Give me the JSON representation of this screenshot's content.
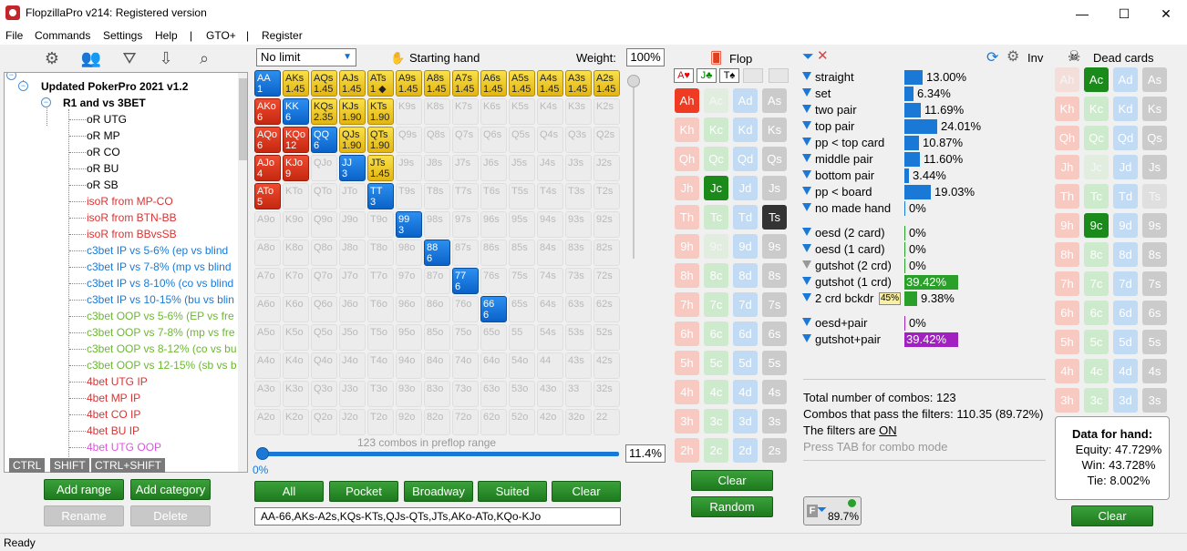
{
  "window": {
    "title": "FlopzillaPro v214: Registered version",
    "min": "—",
    "max": "☐",
    "close": "✕"
  },
  "menu": [
    "File",
    "Commands",
    "Settings",
    "Help",
    "|",
    "GTO+",
    "|",
    "Register"
  ],
  "tree": {
    "root": "Updated PokerPro 2021 v1.2",
    "group": "R1 and vs 3BET",
    "items": [
      {
        "label": "oR UTG",
        "color": "#000000"
      },
      {
        "label": "oR MP",
        "color": "#000000"
      },
      {
        "label": "oR CO",
        "color": "#000000"
      },
      {
        "label": "oR BU",
        "color": "#000000"
      },
      {
        "label": "oR SB",
        "color": "#000000"
      },
      {
        "label": "isoR from MP-CO",
        "color": "#e03030"
      },
      {
        "label": "isoR from BTN-BB",
        "color": "#e03030"
      },
      {
        "label": "isoR from BBvsSB",
        "color": "#e03030"
      },
      {
        "label": "c3bet IP vs 5-6% (ep vs blind",
        "color": "#1a7ad6"
      },
      {
        "label": "c3bet IP vs 7-8% (mp vs blind",
        "color": "#1a7ad6"
      },
      {
        "label": "c3bet IP vs 8-10% (co vs blind",
        "color": "#1a7ad6"
      },
      {
        "label": "c3bet IP vs 10-15% (bu vs blin",
        "color": "#1a7ad6"
      },
      {
        "label": "c3bet OOP vs 5-6% (EP vs fre",
        "color": "#6bb830"
      },
      {
        "label": "c3bet OOP vs 7-8% (mp vs fre",
        "color": "#6bb830"
      },
      {
        "label": "c3bet OOP vs 8-12% (co vs bu",
        "color": "#6bb830"
      },
      {
        "label": "c3bet OOP vs 12-15% (sb vs b",
        "color": "#6bb830"
      },
      {
        "label": "4bet UTG IP",
        "color": "#e03030"
      },
      {
        "label": "4bet MP IP",
        "color": "#e03030"
      },
      {
        "label": "4bet CO IP",
        "color": "#e03030"
      },
      {
        "label": "4bet BU IP",
        "color": "#e03030"
      },
      {
        "label": "4bet UTG OOP",
        "color": "#e050e0"
      }
    ]
  },
  "keytags": [
    "CTRL",
    "SHIFT",
    "CTRL+SHIFT"
  ],
  "tree_buttons": {
    "add_range": "Add range",
    "add_category": "Add category",
    "rename": "Rename",
    "delete": "Delete"
  },
  "range": {
    "mode": "No limit",
    "header": "Starting hand",
    "weight_label": "Weight:",
    "weight": "100%",
    "combos_text": "123 combos in preflop range",
    "slider_left": "0%",
    "percent": "11.4%",
    "buttons": [
      "All",
      "Pocket",
      "Broadway",
      "Suited",
      "Clear"
    ],
    "range_text": "AA-66,AKs-A2s,KQs-KTs,QJs-QTs,JTs,AKo-ATo,KQo-KJo",
    "grid": [
      [
        [
          "AA",
          "1",
          "b"
        ],
        [
          "AKs",
          "1.45",
          "y"
        ],
        [
          "AQs",
          "1.45",
          "y"
        ],
        [
          "AJs",
          "1.45",
          "y"
        ],
        [
          "ATs",
          "1 ◆",
          "y"
        ],
        [
          "A9s",
          "1.45",
          "y"
        ],
        [
          "A8s",
          "1.45",
          "y"
        ],
        [
          "A7s",
          "1.45",
          "y"
        ],
        [
          "A6s",
          "1.45",
          "y"
        ],
        [
          "A5s",
          "1.45",
          "y"
        ],
        [
          "A4s",
          "1.45",
          "y"
        ],
        [
          "A3s",
          "1.45",
          "y"
        ],
        [
          "A2s",
          "1.45",
          "y"
        ]
      ],
      [
        [
          "AKo",
          "6",
          "r"
        ],
        [
          "KK",
          "6",
          "b"
        ],
        [
          "KQs",
          "2.35",
          "y"
        ],
        [
          "KJs",
          "1.90",
          "y"
        ],
        [
          "KTs",
          "1.90",
          "y"
        ],
        [
          "K9s",
          "",
          "e"
        ],
        [
          "K8s",
          "",
          "e"
        ],
        [
          "K7s",
          "",
          "e"
        ],
        [
          "K6s",
          "",
          "e"
        ],
        [
          "K5s",
          "",
          "e"
        ],
        [
          "K4s",
          "",
          "e"
        ],
        [
          "K3s",
          "",
          "e"
        ],
        [
          "K2s",
          "",
          "e"
        ]
      ],
      [
        [
          "AQo",
          "6",
          "r"
        ],
        [
          "KQo",
          "12",
          "r"
        ],
        [
          "QQ",
          "6",
          "b"
        ],
        [
          "QJs",
          "1.90",
          "y"
        ],
        [
          "QTs",
          "1.90",
          "y"
        ],
        [
          "Q9s",
          "",
          "e"
        ],
        [
          "Q8s",
          "",
          "e"
        ],
        [
          "Q7s",
          "",
          "e"
        ],
        [
          "Q6s",
          "",
          "e"
        ],
        [
          "Q5s",
          "",
          "e"
        ],
        [
          "Q4s",
          "",
          "e"
        ],
        [
          "Q3s",
          "",
          "e"
        ],
        [
          "Q2s",
          "",
          "e"
        ]
      ],
      [
        [
          "AJo",
          "4",
          "r"
        ],
        [
          "KJo",
          "9",
          "r"
        ],
        [
          "QJo",
          "",
          "e"
        ],
        [
          "JJ",
          "3",
          "b"
        ],
        [
          "JTs",
          "1.45",
          "y"
        ],
        [
          "J9s",
          "",
          "e"
        ],
        [
          "J8s",
          "",
          "e"
        ],
        [
          "J7s",
          "",
          "e"
        ],
        [
          "J6s",
          "",
          "e"
        ],
        [
          "J5s",
          "",
          "e"
        ],
        [
          "J4s",
          "",
          "e"
        ],
        [
          "J3s",
          "",
          "e"
        ],
        [
          "J2s",
          "",
          "e"
        ]
      ],
      [
        [
          "ATo",
          "5",
          "r"
        ],
        [
          "KTo",
          "",
          "e"
        ],
        [
          "QTo",
          "",
          "e"
        ],
        [
          "JTo",
          "",
          "e"
        ],
        [
          "TT",
          "3",
          "b"
        ],
        [
          "T9s",
          "",
          "e"
        ],
        [
          "T8s",
          "",
          "e"
        ],
        [
          "T7s",
          "",
          "e"
        ],
        [
          "T6s",
          "",
          "e"
        ],
        [
          "T5s",
          "",
          "e"
        ],
        [
          "T4s",
          "",
          "e"
        ],
        [
          "T3s",
          "",
          "e"
        ],
        [
          "T2s",
          "",
          "e"
        ]
      ],
      [
        [
          "A9o",
          "",
          "e"
        ],
        [
          "K9o",
          "",
          "e"
        ],
        [
          "Q9o",
          "",
          "e"
        ],
        [
          "J9o",
          "",
          "e"
        ],
        [
          "T9o",
          "",
          "e"
        ],
        [
          "99",
          "3",
          "b"
        ],
        [
          "98s",
          "",
          "e"
        ],
        [
          "97s",
          "",
          "e"
        ],
        [
          "96s",
          "",
          "e"
        ],
        [
          "95s",
          "",
          "e"
        ],
        [
          "94s",
          "",
          "e"
        ],
        [
          "93s",
          "",
          "e"
        ],
        [
          "92s",
          "",
          "e"
        ]
      ],
      [
        [
          "A8o",
          "",
          "e"
        ],
        [
          "K8o",
          "",
          "e"
        ],
        [
          "Q8o",
          "",
          "e"
        ],
        [
          "J8o",
          "",
          "e"
        ],
        [
          "T8o",
          "",
          "e"
        ],
        [
          "98o",
          "",
          "e"
        ],
        [
          "88",
          "6",
          "b"
        ],
        [
          "87s",
          "",
          "e"
        ],
        [
          "86s",
          "",
          "e"
        ],
        [
          "85s",
          "",
          "e"
        ],
        [
          "84s",
          "",
          "e"
        ],
        [
          "83s",
          "",
          "e"
        ],
        [
          "82s",
          "",
          "e"
        ]
      ],
      [
        [
          "A7o",
          "",
          "e"
        ],
        [
          "K7o",
          "",
          "e"
        ],
        [
          "Q7o",
          "",
          "e"
        ],
        [
          "J7o",
          "",
          "e"
        ],
        [
          "T7o",
          "",
          "e"
        ],
        [
          "97o",
          "",
          "e"
        ],
        [
          "87o",
          "",
          "e"
        ],
        [
          "77",
          "6",
          "b"
        ],
        [
          "76s",
          "",
          "e"
        ],
        [
          "75s",
          "",
          "e"
        ],
        [
          "74s",
          "",
          "e"
        ],
        [
          "73s",
          "",
          "e"
        ],
        [
          "72s",
          "",
          "e"
        ]
      ],
      [
        [
          "A6o",
          "",
          "e"
        ],
        [
          "K6o",
          "",
          "e"
        ],
        [
          "Q6o",
          "",
          "e"
        ],
        [
          "J6o",
          "",
          "e"
        ],
        [
          "T6o",
          "",
          "e"
        ],
        [
          "96o",
          "",
          "e"
        ],
        [
          "86o",
          "",
          "e"
        ],
        [
          "76o",
          "",
          "e"
        ],
        [
          "66",
          "6",
          "b"
        ],
        [
          "65s",
          "",
          "e"
        ],
        [
          "64s",
          "",
          "e"
        ],
        [
          "63s",
          "",
          "e"
        ],
        [
          "62s",
          "",
          "e"
        ]
      ],
      [
        [
          "A5o",
          "",
          "e"
        ],
        [
          "K5o",
          "",
          "e"
        ],
        [
          "Q5o",
          "",
          "e"
        ],
        [
          "J5o",
          "",
          "e"
        ],
        [
          "T5o",
          "",
          "e"
        ],
        [
          "95o",
          "",
          "e"
        ],
        [
          "85o",
          "",
          "e"
        ],
        [
          "75o",
          "",
          "e"
        ],
        [
          "65o",
          "",
          "e"
        ],
        [
          "55",
          "",
          "e"
        ],
        [
          "54s",
          "",
          "e"
        ],
        [
          "53s",
          "",
          "e"
        ],
        [
          "52s",
          "",
          "e"
        ]
      ],
      [
        [
          "A4o",
          "",
          "e"
        ],
        [
          "K4o",
          "",
          "e"
        ],
        [
          "Q4o",
          "",
          "e"
        ],
        [
          "J4o",
          "",
          "e"
        ],
        [
          "T4o",
          "",
          "e"
        ],
        [
          "94o",
          "",
          "e"
        ],
        [
          "84o",
          "",
          "e"
        ],
        [
          "74o",
          "",
          "e"
        ],
        [
          "64o",
          "",
          "e"
        ],
        [
          "54o",
          "",
          "e"
        ],
        [
          "44",
          "",
          "e"
        ],
        [
          "43s",
          "",
          "e"
        ],
        [
          "42s",
          "",
          "e"
        ]
      ],
      [
        [
          "A3o",
          "",
          "e"
        ],
        [
          "K3o",
          "",
          "e"
        ],
        [
          "Q3o",
          "",
          "e"
        ],
        [
          "J3o",
          "",
          "e"
        ],
        [
          "T3o",
          "",
          "e"
        ],
        [
          "93o",
          "",
          "e"
        ],
        [
          "83o",
          "",
          "e"
        ],
        [
          "73o",
          "",
          "e"
        ],
        [
          "63o",
          "",
          "e"
        ],
        [
          "53o",
          "",
          "e"
        ],
        [
          "43o",
          "",
          "e"
        ],
        [
          "33",
          "",
          "e"
        ],
        [
          "32s",
          "",
          "e"
        ]
      ],
      [
        [
          "A2o",
          "",
          "e"
        ],
        [
          "K2o",
          "",
          "e"
        ],
        [
          "Q2o",
          "",
          "e"
        ],
        [
          "J2o",
          "",
          "e"
        ],
        [
          "T2o",
          "",
          "e"
        ],
        [
          "92o",
          "",
          "e"
        ],
        [
          "82o",
          "",
          "e"
        ],
        [
          "72o",
          "",
          "e"
        ],
        [
          "62o",
          "",
          "e"
        ],
        [
          "52o",
          "",
          "e"
        ],
        [
          "42o",
          "",
          "e"
        ],
        [
          "32o",
          "",
          "e"
        ],
        [
          "22",
          "",
          "e"
        ]
      ]
    ]
  },
  "flop": {
    "header": "Flop",
    "selected": [
      "A♥",
      "J♣",
      "T♠"
    ],
    "ranks": [
      "A",
      "K",
      "Q",
      "J",
      "T",
      "9",
      "8",
      "7",
      "6",
      "5",
      "4",
      "3",
      "2"
    ],
    "on": [
      "Ah",
      "Jc",
      "Ts"
    ],
    "dim": [
      "Ac",
      "9c"
    ],
    "clear": "Clear",
    "random": "Random"
  },
  "stats": {
    "items": [
      {
        "name": "straight",
        "pct": "13.00%",
        "value": 13.0,
        "color": "#1a78d6"
      },
      {
        "name": "set",
        "pct": "6.34%",
        "value": 6.34,
        "color": "#1a78d6"
      },
      {
        "name": "two pair",
        "pct": "11.69%",
        "value": 11.69,
        "color": "#1a78d6"
      },
      {
        "name": "top pair",
        "pct": "24.01%",
        "value": 24.01,
        "color": "#1a78d6"
      },
      {
        "name": "pp < top card",
        "pct": "10.87%",
        "value": 10.87,
        "color": "#1a78d6"
      },
      {
        "name": "middle pair",
        "pct": "11.60%",
        "value": 11.6,
        "color": "#1a78d6"
      },
      {
        "name": "bottom pair",
        "pct": "3.44%",
        "value": 3.44,
        "color": "#1a78d6"
      },
      {
        "name": "pp < board",
        "pct": "19.03%",
        "value": 19.03,
        "color": "#1a78d6"
      },
      {
        "name": "no made hand",
        "pct": "0%",
        "value": 0,
        "color": "#1a78d6"
      },
      {
        "name": "oesd (2 card)",
        "pct": "0%",
        "value": 0,
        "color": "#2aa02a"
      },
      {
        "name": "oesd (1 card)",
        "pct": "0%",
        "value": 0,
        "color": "#2aa02a"
      },
      {
        "name": "gutshot (2 crd)",
        "pct": "0%",
        "value": 0,
        "color": "#2aa02a"
      },
      {
        "name": "gutshot (1 crd)",
        "pct": "39.42%",
        "value": 39.42,
        "color": "#2aa02a"
      },
      {
        "name": "2 crd bckdr",
        "pct": "9.38%",
        "value": 9.38,
        "color": "#2aa02a",
        "badge": "45%"
      },
      {
        "name": "oesd+pair",
        "pct": "0%",
        "value": 0,
        "color": "#a020c0"
      },
      {
        "name": "gutshot+pair",
        "pct": "39.42%",
        "value": 39.42,
        "color": "#a020c0"
      }
    ],
    "inv": "Inv",
    "total": "Total number of combos: 123",
    "pass": "Combos that pass the filters: 110.35 (89.72%)",
    "filters_on_prefix": "The filters are ",
    "filters_on": "ON",
    "tab_hint": "Press TAB for combo mode",
    "fbadge": "89.7%"
  },
  "dead": {
    "header": "Dead cards",
    "on": [
      "Ac",
      "9c"
    ],
    "dim": [
      "Ah",
      "Jc",
      "Ts"
    ],
    "clear": "Clear"
  },
  "handdata": {
    "title": "Data for hand:",
    "equity": "Equity: 47.729%",
    "win": "Win: 43.728%",
    "tie": "Tie: 8.002%"
  },
  "status": "Ready"
}
